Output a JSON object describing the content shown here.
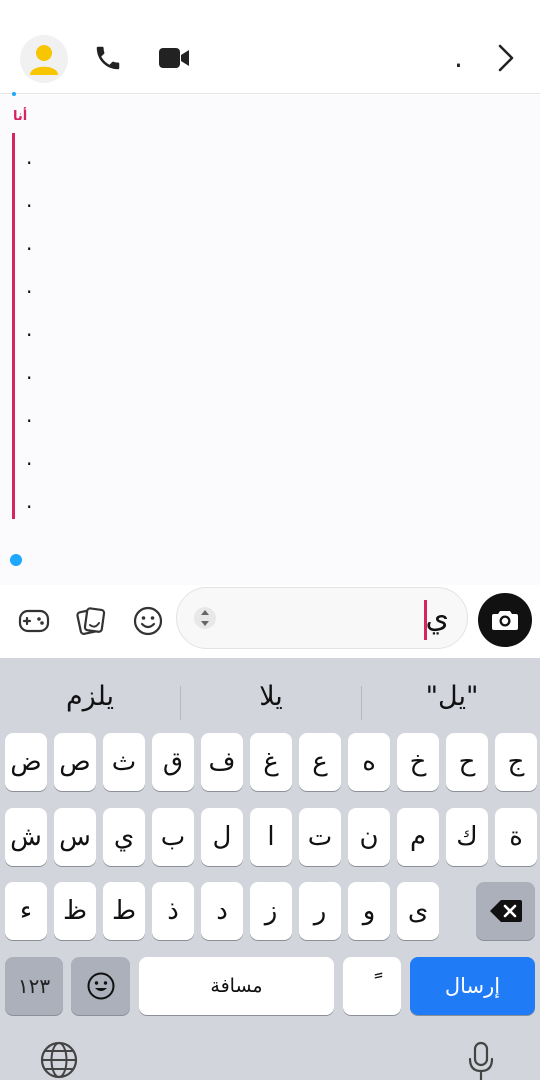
{
  "header": {
    "title": ".",
    "icons": [
      "avatar-icon",
      "phone-icon",
      "video-camera-icon",
      "chevron-right-icon"
    ]
  },
  "chat": {
    "sender": "أنا",
    "lines": [
      ".",
      ".",
      ".",
      ".",
      ".",
      ".",
      ".",
      ".",
      "."
    ]
  },
  "composer": {
    "input_value": "ي",
    "icons": [
      "game-controller-icon",
      "stickers-icon",
      "smiley-icon",
      "sort-arrows-icon",
      "camera-icon"
    ]
  },
  "keyboard": {
    "suggestions": [
      "يلزم",
      "يلا",
      "\"يل\""
    ],
    "row1": [
      "ض",
      "ص",
      "ث",
      "ق",
      "ف",
      "غ",
      "ع",
      "ه",
      "خ",
      "ح",
      "ج"
    ],
    "row2": [
      "ش",
      "س",
      "ي",
      "ب",
      "ل",
      "ا",
      "ت",
      "ن",
      "م",
      "ك",
      "ة"
    ],
    "row3": [
      "ء",
      "ظ",
      "ط",
      "ذ",
      "د",
      "ز",
      "ر",
      "و",
      "ى"
    ],
    "num_label": "١٢٣",
    "space_label": "مسافة",
    "tanween_label": "ً",
    "send_label": "إرسال"
  },
  "colors": {
    "accent": "#d7235f",
    "send": "#1f7bf6",
    "online": "#1ea7ff"
  }
}
